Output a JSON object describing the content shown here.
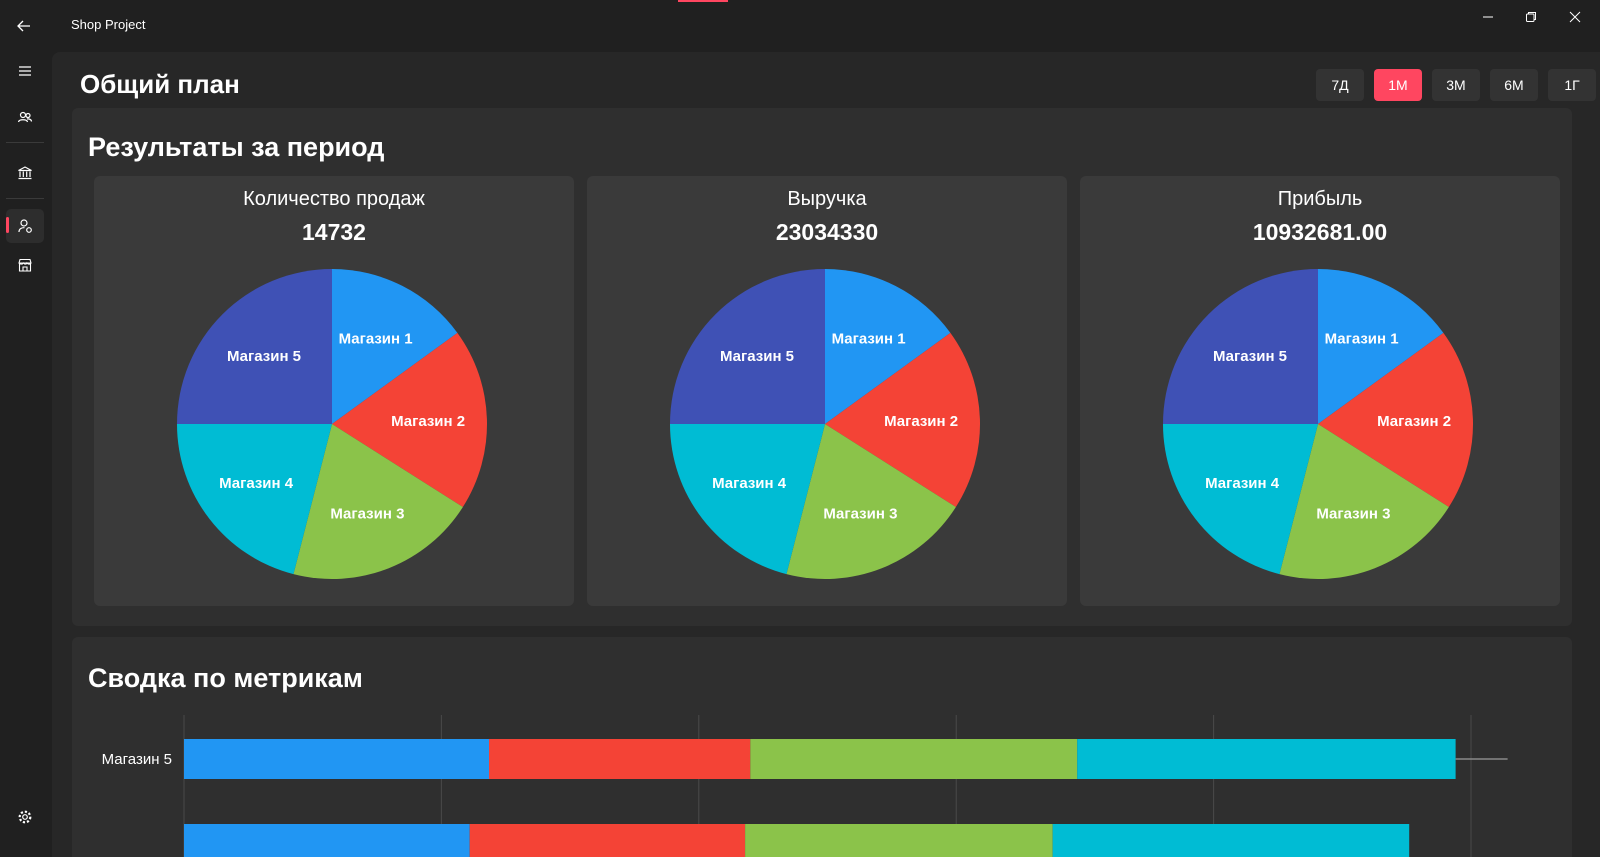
{
  "app": {
    "title": "Shop Project"
  },
  "nav": {
    "items": [
      {
        "icon": "menu-icon"
      },
      {
        "icon": "users-icon"
      },
      {
        "icon": "bank-icon"
      },
      {
        "icon": "user-settings-icon",
        "active": true
      },
      {
        "icon": "store-icon"
      },
      {
        "icon": "settings-icon"
      }
    ]
  },
  "page": {
    "title": "Общий план"
  },
  "periods": [
    {
      "label": "7Д",
      "selected": false
    },
    {
      "label": "1М",
      "selected": true
    },
    {
      "label": "3М",
      "selected": false
    },
    {
      "label": "6М",
      "selected": false
    },
    {
      "label": "1Г",
      "selected": false
    }
  ],
  "results": {
    "title": "Результаты за период",
    "cards": [
      {
        "title": "Количество продаж",
        "value": "14732"
      },
      {
        "title": "Выручка",
        "value": "23034330"
      },
      {
        "title": "Прибыль",
        "value": "10932681.00"
      }
    ]
  },
  "metrics": {
    "title": "Сводка по метрикам"
  },
  "colors": {
    "accent": "#ff4660",
    "store1": "#2196f3",
    "store2": "#f44336",
    "store3": "#8bc34a",
    "store4": "#00bcd4",
    "store5": "#3f51b5"
  },
  "chart_data": [
    {
      "type": "pie",
      "title": "Количество продаж",
      "categories": [
        "Магазин 1",
        "Магазин 2",
        "Магазин 3",
        "Магазин 4",
        "Магазин 5"
      ],
      "values": [
        15,
        19,
        20,
        21,
        25
      ]
    },
    {
      "type": "pie",
      "title": "Выручка",
      "categories": [
        "Магазин 1",
        "Магазин 2",
        "Магазин 3",
        "Магазин 4",
        "Магазин 5"
      ],
      "values": [
        15,
        19,
        20,
        21,
        25
      ]
    },
    {
      "type": "pie",
      "title": "Прибыль",
      "categories": [
        "Магазин 1",
        "Магазин 2",
        "Магазин 3",
        "Магазин 4",
        "Магазин 5"
      ],
      "values": [
        15,
        19,
        20,
        21,
        25
      ]
    },
    {
      "type": "bar",
      "orientation": "horizontal",
      "stacked": true,
      "categories": [
        "Магазин 5",
        ""
      ],
      "series": [
        {
          "values": [
            23.7,
            22.2
          ]
        },
        {
          "values": [
            20.3,
            21.4
          ]
        },
        {
          "values": [
            25.4,
            23.9
          ]
        },
        {
          "values": [
            29.4,
            27.7
          ]
        }
      ],
      "xlim": [
        0,
        100
      ],
      "grid": true
    }
  ]
}
